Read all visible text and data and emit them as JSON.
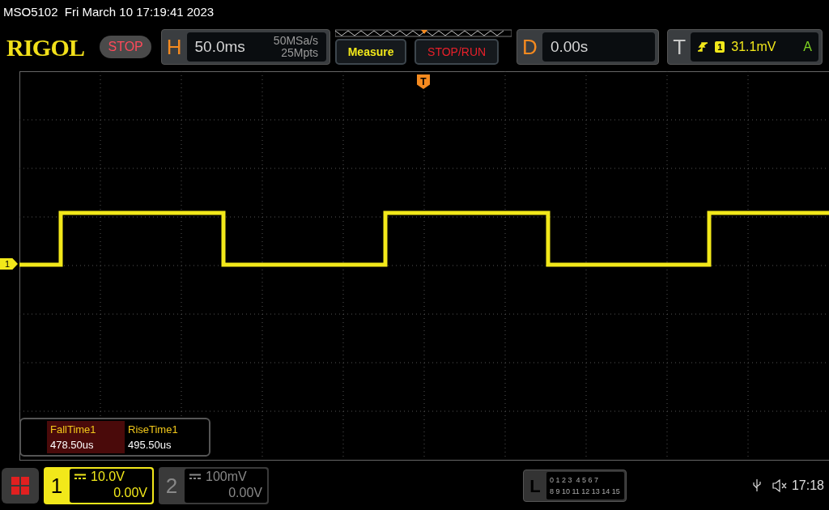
{
  "header": {
    "model_datetime": "MSO5102  Fri March 10 17:19:41 2023"
  },
  "toolbar": {
    "logo": "RIGOL",
    "run_state": "STOP",
    "horizontal": {
      "label": "H",
      "timebase": "50.0ms",
      "sample_rate": "50MSa/s",
      "memory_depth": "25Mpts"
    },
    "buttons": [
      {
        "label": "Measure",
        "kind": "menu"
      },
      {
        "label": "STOP/RUN",
        "kind": "runstop"
      }
    ],
    "delay": {
      "label": "D",
      "value": "0.00s"
    },
    "trigger": {
      "label": "T",
      "source": "1",
      "level": "31.1mV",
      "mode": "A"
    }
  },
  "graticule": {
    "trigger_marker": "T",
    "channel_marker": "1"
  },
  "measurements": [
    {
      "name": "FallTime1",
      "value": "478.50us",
      "selected": true
    },
    {
      "name": "RiseTime1",
      "value": "495.50us",
      "selected": false
    }
  ],
  "channels": [
    {
      "number": "1",
      "scale": "10.0V",
      "offset": "0.00V",
      "active": true
    },
    {
      "number": "2",
      "scale": "100mV",
      "offset": "0.00V",
      "active": false
    }
  ],
  "logic": {
    "label": "L",
    "rows": [
      "0 1 2 3  4 5 6 7",
      "8 9 10 11 12 13 14 15"
    ]
  },
  "status": {
    "time": "17:18"
  }
}
